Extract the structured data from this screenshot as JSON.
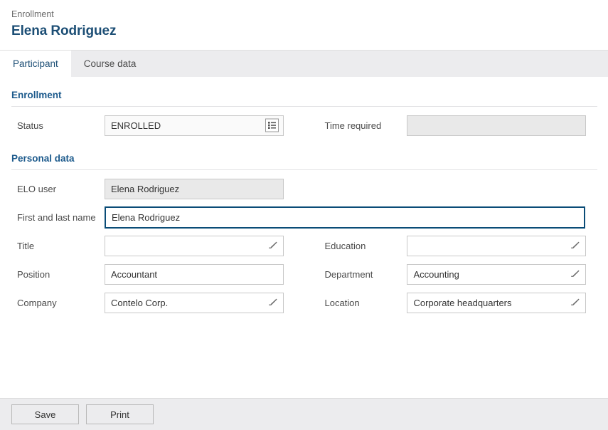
{
  "header": {
    "breadcrumb": "Enrollment",
    "title": "Elena Rodriguez"
  },
  "tabs": [
    {
      "label": "Participant",
      "active": true
    },
    {
      "label": "Course data",
      "active": false
    }
  ],
  "sections": [
    {
      "title": "Enrollment",
      "rows": [
        {
          "left": {
            "label": "Status",
            "value": "ENROLLED",
            "icon": "list-picker-icon",
            "state": "readonly-light"
          },
          "right": {
            "label": "Time required",
            "value": "",
            "icon": "none",
            "state": "disabled"
          }
        }
      ]
    },
    {
      "title": "Personal data",
      "rows": [
        {
          "left": {
            "label": "ELO user",
            "value": "Elena Rodriguez",
            "icon": "none",
            "state": "disabled"
          },
          "right": null
        },
        {
          "left": {
            "label": "First and last name",
            "value": "Elena Rodriguez",
            "icon": "none",
            "state": "focused"
          },
          "right": null
        },
        {
          "left": {
            "label": "Title",
            "value": "",
            "icon": "pencil-icon",
            "state": "normal"
          },
          "right": {
            "label": "Education",
            "value": "",
            "icon": "pencil-icon",
            "state": "normal"
          }
        },
        {
          "left": {
            "label": "Position",
            "value": "Accountant",
            "icon": "none",
            "state": "normal"
          },
          "right": {
            "label": "Department",
            "value": "Accounting",
            "icon": "pencil-icon",
            "state": "normal"
          }
        },
        {
          "left": {
            "label": "Company",
            "value": "Contelo Corp.",
            "icon": "pencil-icon",
            "state": "normal"
          },
          "right": {
            "label": "Location",
            "value": "Corporate headquarters",
            "icon": "pencil-icon",
            "state": "normal"
          }
        }
      ]
    }
  ],
  "footer": {
    "save_label": "Save",
    "print_label": "Print"
  },
  "colors": {
    "title_blue": "#1c4e75",
    "section_blue": "#1c5a8c",
    "focus_border": "#0a4c77",
    "tab_inactive_bg": "#ececee",
    "footer_bg": "#ececee",
    "disabled_bg": "#e9e9e9"
  }
}
